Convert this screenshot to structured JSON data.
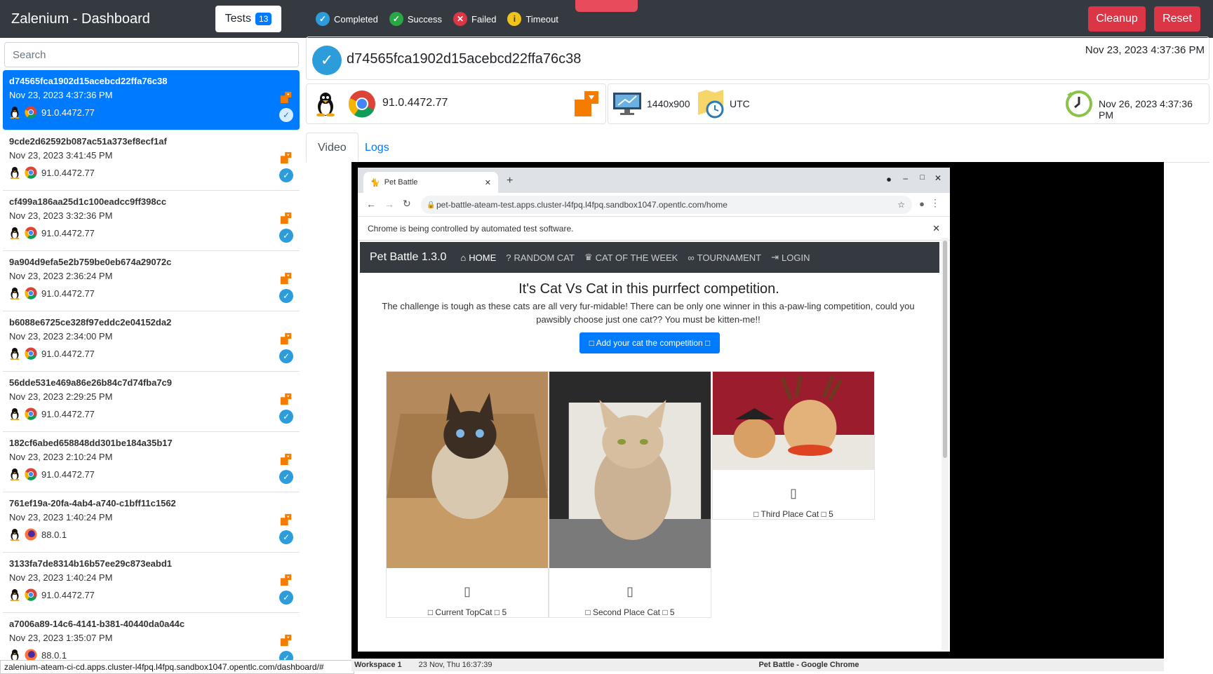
{
  "nav": {
    "brand": "Zalenium - Dashboard",
    "tests_label": "Tests",
    "tests_count": "13",
    "legend": {
      "completed": "Completed",
      "success": "Success",
      "failed": "Failed",
      "timeout": "Timeout"
    },
    "cleanup": "Cleanup",
    "reset": "Reset"
  },
  "search": {
    "placeholder": "Search"
  },
  "tests": [
    {
      "id": "d74565fca1902d15acebcd22ffa76c38",
      "date": "Nov 23, 2023 4:37:36 PM",
      "version": "91.0.4472.77",
      "browser": "chrome-icon"
    },
    {
      "id": "9cde2d62592b087ac51a373ef8ecf1af",
      "date": "Nov 23, 2023 3:41:45 PM",
      "version": "91.0.4472.77",
      "browser": "chrome-icon"
    },
    {
      "id": "cf499a186aa25d1c100eadcc9ff398cc",
      "date": "Nov 23, 2023 3:32:36 PM",
      "version": "91.0.4472.77",
      "browser": "chrome-icon"
    },
    {
      "id": "9a904d9efa5e2b759be0eb674a29072c",
      "date": "Nov 23, 2023 2:36:24 PM",
      "version": "91.0.4472.77",
      "browser": "chrome-icon"
    },
    {
      "id": "b6088e6725ce328f97eddc2e04152da2",
      "date": "Nov 23, 2023 2:34:00 PM",
      "version": "91.0.4472.77",
      "browser": "chrome-icon"
    },
    {
      "id": "56dde531e469a86e26b84c7d74fba7c9",
      "date": "Nov 23, 2023 2:29:25 PM",
      "version": "91.0.4472.77",
      "browser": "chrome-icon"
    },
    {
      "id": "182cf6abed658848dd301be184a35b17",
      "date": "Nov 23, 2023 2:10:24 PM",
      "version": "91.0.4472.77",
      "browser": "chrome-icon"
    },
    {
      "id": "761ef19a-20fa-4ab4-a740-c1bff11c1562",
      "date": "Nov 23, 2023 1:40:24 PM",
      "version": "88.0.1",
      "browser": "firefox-icon"
    },
    {
      "id": "3133fa7de8314b16b57ee29c873eabd1",
      "date": "Nov 23, 2023 1:40:24 PM",
      "version": "91.0.4472.77",
      "browser": "chrome-icon"
    },
    {
      "id": "a7006a89-14c6-4141-b381-40440da0a44c",
      "date": "Nov 23, 2023 1:35:07 PM",
      "version": "88.0.1",
      "browser": "firefox-icon"
    }
  ],
  "status_url": "zalenium-ateam-ci-cd.apps.cluster-l4fpq.l4fpq.sandbox1047.opentlc.com/dashboard/#",
  "detail": {
    "id": "d74565fca1902d15acebcd22ffa76c38",
    "time": "Nov 23, 2023 4:37:36 PM",
    "version": "91.0.4472.77",
    "resolution": "1440x900",
    "timezone": "UTC",
    "retention": "Nov 26, 2023 4:37:36 PM"
  },
  "tabs": {
    "video": "Video",
    "logs": "Logs"
  },
  "browser": {
    "tab_title": "Pet Battle",
    "url": "pet-battle-ateam-test.apps.cluster-l4fpq.l4fpq.sandbox1047.opentlc.com/home",
    "infobar": "Chrome is being controlled by automated test software.",
    "app": {
      "brand": "Pet Battle 1.3.0",
      "nav": [
        "HOME",
        "RANDOM CAT",
        "CAT OF THE WEEK",
        "TOURNAMENT",
        "LOGIN"
      ],
      "heading": "It's Cat Vs Cat in this purrfect competition.",
      "text": "The challenge is tough as these cats are all very fur-midable! There can be only one winner in this a-paw-ling competition, could you pawsibly choose just one cat?? You must be kitten-me!!",
      "add_button": "□ Add your cat the competition □",
      "cards": [
        {
          "label": "□ Current TopCat □ 5"
        },
        {
          "label": "□ Second Place Cat □ 5"
        },
        {
          "label": "□ Third Place Cat □ 5"
        }
      ]
    }
  },
  "taskbar": {
    "workspace": "Workspace 1",
    "clock": "23 Nov, Thu 16:37:39",
    "window": "Pet Battle - Google Chrome"
  }
}
